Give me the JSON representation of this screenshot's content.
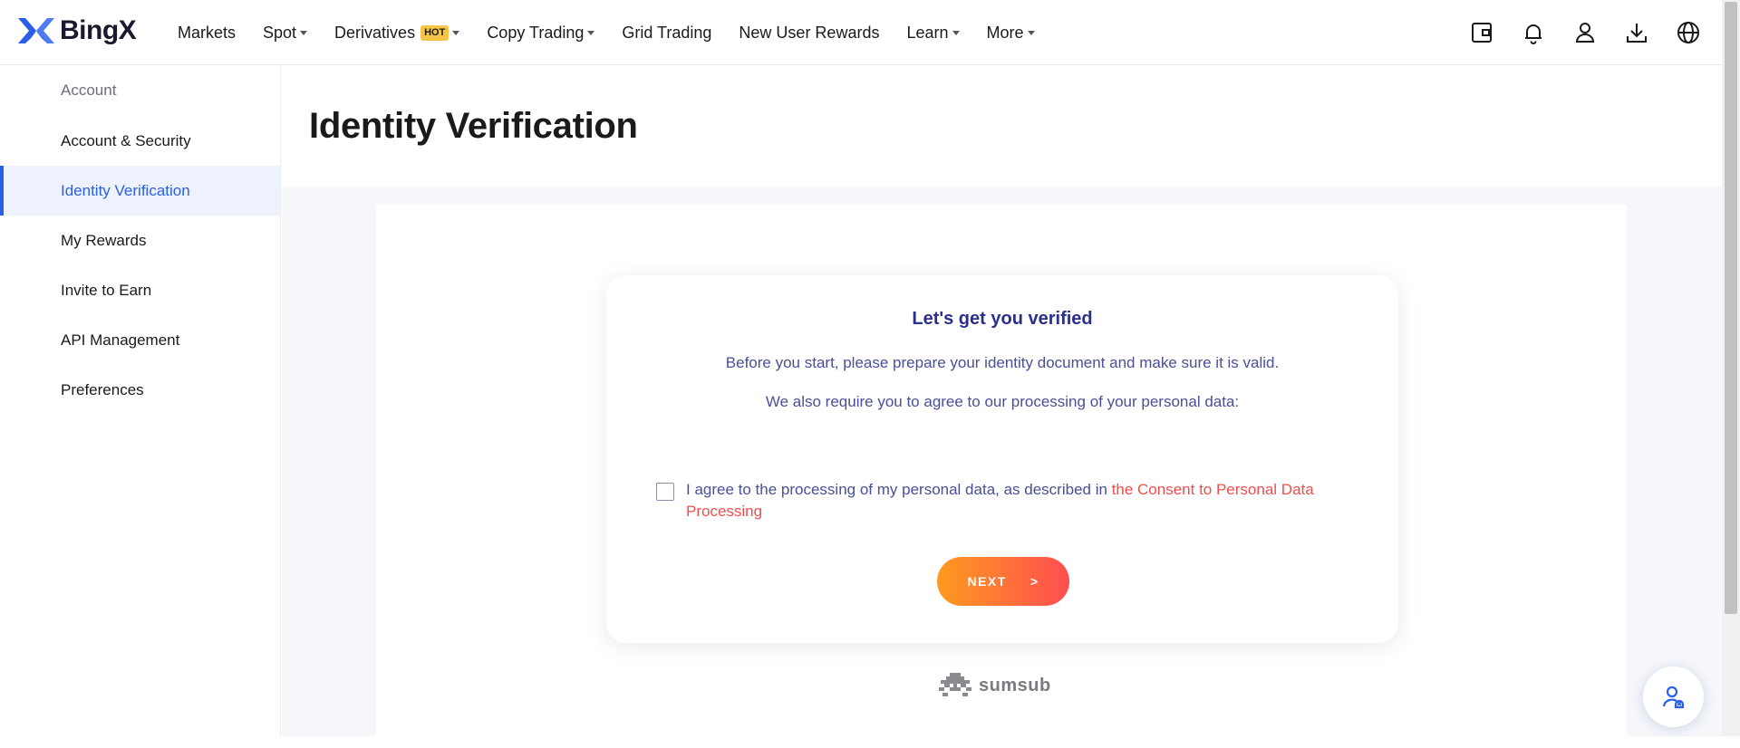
{
  "brand": {
    "name": "BingX",
    "accent": "#2b5ee8"
  },
  "nav": {
    "items": [
      {
        "label": "Markets",
        "dropdown": false
      },
      {
        "label": "Spot",
        "dropdown": true
      },
      {
        "label": "Derivatives",
        "dropdown": true,
        "badge": "HOT"
      },
      {
        "label": "Copy Trading",
        "dropdown": true
      },
      {
        "label": "Grid Trading",
        "dropdown": false
      },
      {
        "label": "New User Rewards",
        "dropdown": false
      },
      {
        "label": "Learn",
        "dropdown": true
      },
      {
        "label": "More",
        "dropdown": true
      }
    ],
    "icons": [
      "wallet-icon",
      "bell-icon",
      "user-icon",
      "download-icon",
      "globe-icon"
    ]
  },
  "sidebar": {
    "header": "Account",
    "items": [
      {
        "label": "Account & Security",
        "active": false
      },
      {
        "label": "Identity Verification",
        "active": true
      },
      {
        "label": "My Rewards",
        "active": false
      },
      {
        "label": "Invite to Earn",
        "active": false
      },
      {
        "label": "API Management",
        "active": false
      },
      {
        "label": "Preferences",
        "active": false
      }
    ]
  },
  "main": {
    "title": "Identity Verification",
    "card": {
      "title": "Let's get you verified",
      "line1": "Before you start, please prepare your identity document and make sure it is valid.",
      "line2": "We also require you to agree to our processing of your personal data:",
      "consent_text": "I agree to the processing of my personal data, as described in ",
      "consent_link": "the Consent to Personal Data Processing",
      "consent_checked": false,
      "next_label": "NEXT",
      "next_arrow": ">"
    },
    "powered_by": "sumsub"
  },
  "colors": {
    "card_title": "#2a2f8f",
    "card_text": "#4a4f96",
    "link": "#f04e4e",
    "button_gradient_start": "#ff9a1f",
    "button_gradient_end": "#ff4e50"
  }
}
